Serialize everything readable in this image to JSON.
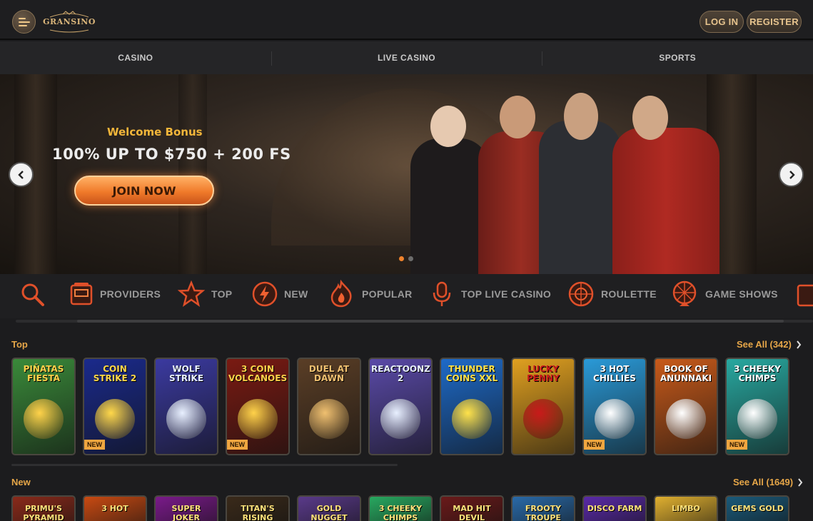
{
  "header": {
    "logo_text": "GRANSINO",
    "login_label": "LOG IN",
    "register_label": "REGISTER"
  },
  "nav": {
    "tabs": [
      {
        "label": "CASINO"
      },
      {
        "label": "LIVE CASINO"
      },
      {
        "label": "SPORTS"
      }
    ]
  },
  "hero": {
    "subtitle": "Welcome Bonus",
    "title": "100% UP TO $750 + 200 FS",
    "cta": "JOIN NOW",
    "active_slide": 1,
    "slide_count": 2
  },
  "categories": [
    {
      "label": "",
      "icon": "search-icon"
    },
    {
      "label": "PROVIDERS",
      "icon": "slot-machine-icon"
    },
    {
      "label": "TOP",
      "icon": "star-icon"
    },
    {
      "label": "NEW",
      "icon": "lightning-icon"
    },
    {
      "label": "POPULAR",
      "icon": "flame-icon"
    },
    {
      "label": "TOP LIVE CASINO",
      "icon": "microphone-icon"
    },
    {
      "label": "ROULETTE",
      "icon": "roulette-icon"
    },
    {
      "label": "GAME SHOWS",
      "icon": "wheel-icon"
    },
    {
      "label": "",
      "icon": "cards-icon"
    }
  ],
  "top_section": {
    "title": "Top",
    "see_all": "See All (342)",
    "games": [
      {
        "name": "PIÑATAS FIESTA",
        "new": false,
        "bg": "#3a8a3a",
        "fg": "#ffd24a"
      },
      {
        "name": "COIN STRIKE 2",
        "new": true,
        "badge": "NEW",
        "bg": "#1a2a8c",
        "fg": "#ffd84a"
      },
      {
        "name": "WOLF STRIKE",
        "new": false,
        "bg": "#3b3aa0",
        "fg": "#e8f0ff"
      },
      {
        "name": "3 COIN VOLCANOES",
        "new": true,
        "badge": "NEW",
        "bg": "#7a1a12",
        "fg": "#ffd24a"
      },
      {
        "name": "DUEL AT DAWN",
        "new": false,
        "bg": "#5a3e26",
        "fg": "#f0c070"
      },
      {
        "name": "REACTOONZ 2",
        "new": false,
        "bg": "#5a4aa8",
        "fg": "#e8f0ff"
      },
      {
        "name": "THUNDER COINS XXL",
        "new": false,
        "bg": "#1e6ac8",
        "fg": "#ffe24a"
      },
      {
        "name": "LUCKY PENNY",
        "new": false,
        "bg": "#e0a020",
        "fg": "#c81a1a"
      },
      {
        "name": "3 HOT CHILLIES",
        "new": true,
        "badge": "NEW",
        "bg": "#2a9ad8",
        "fg": "#ffffff"
      },
      {
        "name": "BOOK OF ANUNNAKI",
        "new": false,
        "bg": "#c85a1a",
        "fg": "#ffffff"
      },
      {
        "name": "3 CHEEKY CHIMPS",
        "new": true,
        "badge": "NEW",
        "bg": "#28a8a0",
        "fg": "#ffffff"
      }
    ]
  },
  "new_section": {
    "title": "New",
    "see_all": "See All (1649)",
    "games": [
      {
        "name": "PRIMU'S PYRAMID",
        "bg": "#8a2a1a"
      },
      {
        "name": "3 HOT",
        "bg": "#c84a12"
      },
      {
        "name": "SUPER JOKER",
        "bg": "#7a1a8a"
      },
      {
        "name": "TITAN'S RISING",
        "bg": "#3a2a1a"
      },
      {
        "name": "GOLD NUGGET",
        "bg": "#5a3a8a"
      },
      {
        "name": "3 CHEEKY CHIMPS",
        "bg": "#28a860"
      },
      {
        "name": "MAD HIT DEVIL",
        "bg": "#6a1a1a"
      },
      {
        "name": "FROOTY TROUPE",
        "bg": "#2a6aa8"
      },
      {
        "name": "DISCO FARM",
        "bg": "#5a2aa8"
      },
      {
        "name": "LIMBO",
        "bg": "#e0b030"
      },
      {
        "name": "GEMS GOLD",
        "bg": "#1a5a7a"
      }
    ]
  }
}
